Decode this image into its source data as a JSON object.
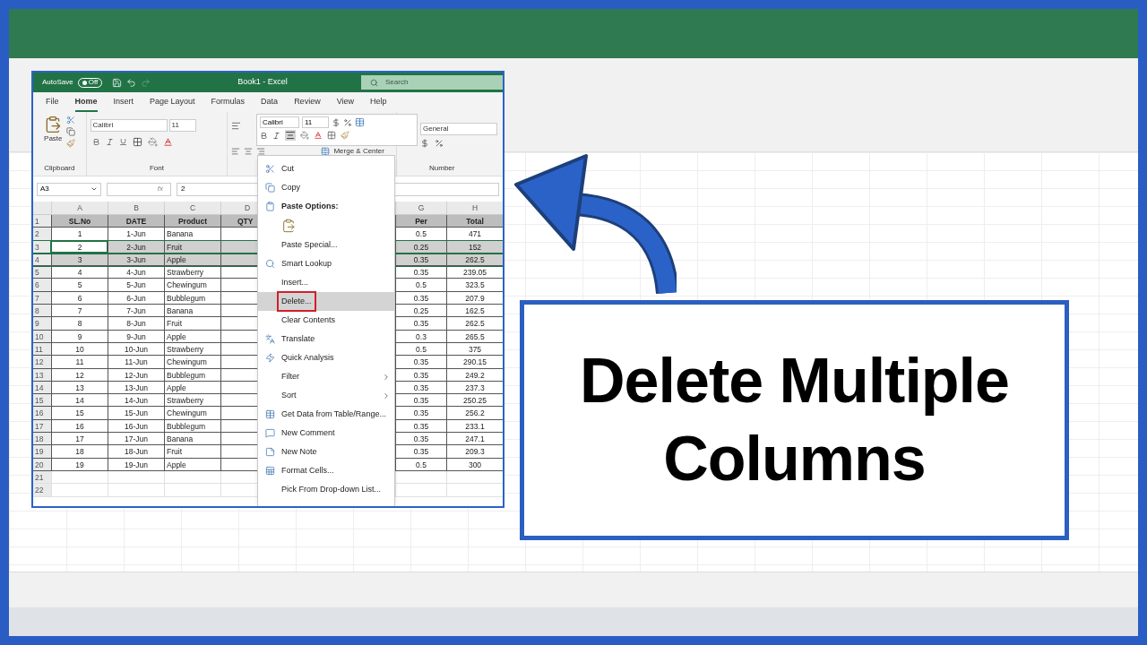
{
  "excel": {
    "autosave": {
      "label": "AutoSave",
      "on": false,
      "state_text": "Off"
    },
    "title": "Book1 - Excel",
    "search": {
      "placeholder": "Search"
    },
    "tabs": [
      {
        "label": "File",
        "selected": false
      },
      {
        "label": "Home",
        "selected": true
      },
      {
        "label": "Insert",
        "selected": false
      },
      {
        "label": "Page Layout",
        "selected": false
      },
      {
        "label": "Formulas",
        "selected": false
      },
      {
        "label": "Data",
        "selected": false
      },
      {
        "label": "Review",
        "selected": false
      },
      {
        "label": "View",
        "selected": false
      },
      {
        "label": "Help",
        "selected": false
      }
    ],
    "ribbon": {
      "paste_label": "Paste",
      "font_name": "Calibri",
      "font_size": "11",
      "merge_label": "Merge & Center",
      "number_format": "General",
      "groups": [
        "Clipboard",
        "Font",
        "Number"
      ]
    },
    "mini_toolbar": {
      "font_name": "Calibri",
      "font_size": "11"
    },
    "name_box": "A3",
    "function_label": "fx",
    "formula": "2",
    "columns": [
      "A",
      "B",
      "C",
      "D",
      "G",
      "H"
    ],
    "rows": [
      {
        "number": "1",
        "kind": "header",
        "selected": false,
        "active": false,
        "a": "SL.No",
        "b": "DATE",
        "c": "Product",
        "d": "QTY",
        "g": "Per",
        "h": "Total"
      },
      {
        "number": "2",
        "kind": "data",
        "selected": false,
        "active": false,
        "a": "1",
        "b": "1-Jun",
        "c": "Banana",
        "g": "0.5",
        "h": "471"
      },
      {
        "number": "3",
        "kind": "data",
        "selected": true,
        "active": true,
        "a": "2",
        "b": "2-Jun",
        "c": "Fruit",
        "g": "0.25",
        "h": "152"
      },
      {
        "number": "4",
        "kind": "data",
        "selected": true,
        "active": false,
        "a": "3",
        "b": "3-Jun",
        "c": "Apple",
        "g": "0.35",
        "h": "262.5"
      },
      {
        "number": "5",
        "kind": "data",
        "selected": false,
        "active": false,
        "a": "4",
        "b": "4-Jun",
        "c": "Strawberry",
        "g": "0.35",
        "h": "239.05"
      },
      {
        "number": "6",
        "kind": "data",
        "selected": false,
        "active": false,
        "a": "5",
        "b": "5-Jun",
        "c": "Chewingum",
        "g": "0.5",
        "h": "323.5"
      },
      {
        "number": "7",
        "kind": "data",
        "selected": false,
        "active": false,
        "a": "6",
        "b": "6-Jun",
        "c": "Bubblegum",
        "g": "0.35",
        "h": "207.9"
      },
      {
        "number": "8",
        "kind": "data",
        "selected": false,
        "active": false,
        "a": "7",
        "b": "7-Jun",
        "c": "Banana",
        "g": "0.25",
        "h": "162.5"
      },
      {
        "number": "9",
        "kind": "data",
        "selected": false,
        "active": false,
        "a": "8",
        "b": "8-Jun",
        "c": "Fruit",
        "g": "0.35",
        "h": "262.5"
      },
      {
        "number": "10",
        "kind": "data",
        "selected": false,
        "active": false,
        "a": "9",
        "b": "9-Jun",
        "c": "Apple",
        "g": "0.3",
        "h": "265.5"
      },
      {
        "number": "11",
        "kind": "data",
        "selected": false,
        "active": false,
        "a": "10",
        "b": "10-Jun",
        "c": "Strawberry",
        "g": "0.5",
        "h": "375"
      },
      {
        "number": "12",
        "kind": "data",
        "selected": false,
        "active": false,
        "a": "11",
        "b": "11-Jun",
        "c": "Chewingum",
        "g": "0.35",
        "h": "290.15"
      },
      {
        "number": "13",
        "kind": "data",
        "selected": false,
        "active": false,
        "a": "12",
        "b": "12-Jun",
        "c": "Bubblegum",
        "g": "0.35",
        "h": "249.2"
      },
      {
        "number": "14",
        "kind": "data",
        "selected": false,
        "active": false,
        "a": "13",
        "b": "13-Jun",
        "c": "Apple",
        "g": "0.35",
        "h": "237.3"
      },
      {
        "number": "15",
        "kind": "data",
        "selected": false,
        "active": false,
        "a": "14",
        "b": "14-Jun",
        "c": "Strawberry",
        "g": "0.35",
        "h": "250.25"
      },
      {
        "number": "16",
        "kind": "data",
        "selected": false,
        "active": false,
        "a": "15",
        "b": "15-Jun",
        "c": "Chewingum",
        "g": "0.35",
        "h": "256.2"
      },
      {
        "number": "17",
        "kind": "data",
        "selected": false,
        "active": false,
        "a": "16",
        "b": "16-Jun",
        "c": "Bubblegum",
        "g": "0.35",
        "h": "233.1"
      },
      {
        "number": "18",
        "kind": "data",
        "selected": false,
        "active": false,
        "a": "17",
        "b": "17-Jun",
        "c": "Banana",
        "g": "0.35",
        "h": "247.1"
      },
      {
        "number": "19",
        "kind": "data",
        "selected": false,
        "active": false,
        "a": "18",
        "b": "18-Jun",
        "c": "Fruit",
        "g": "0.35",
        "h": "209.3"
      },
      {
        "number": "20",
        "kind": "data",
        "selected": false,
        "active": false,
        "a": "19",
        "b": "19-Jun",
        "c": "Apple",
        "g": "0.5",
        "h": "300"
      },
      {
        "number": "21",
        "kind": "blank",
        "selected": false,
        "active": false
      },
      {
        "number": "22",
        "kind": "blank",
        "selected": false,
        "active": false
      }
    ],
    "context_menu": [
      {
        "label": "Cut",
        "kind": "item",
        "submenu": false,
        "selected": false
      },
      {
        "label": "Copy",
        "kind": "item",
        "submenu": false,
        "selected": false
      },
      {
        "label": "Paste Options:",
        "kind": "header",
        "submenu": false,
        "selected": false
      },
      {
        "kind": "paste-icons",
        "submenu": false,
        "selected": false
      },
      {
        "label": "Paste Special...",
        "kind": "item",
        "submenu": false,
        "selected": false
      },
      {
        "label": "Smart Lookup",
        "kind": "item",
        "submenu": false,
        "selected": false
      },
      {
        "label": "Insert...",
        "kind": "item",
        "submenu": false,
        "selected": false
      },
      {
        "label": "Delete...",
        "kind": "item",
        "submenu": false,
        "selected": true
      },
      {
        "label": "Clear Contents",
        "kind": "item",
        "submenu": false,
        "selected": false
      },
      {
        "label": "Translate",
        "kind": "item",
        "submenu": false,
        "selected": false
      },
      {
        "label": "Quick Analysis",
        "kind": "item",
        "submenu": false,
        "selected": false
      },
      {
        "label": "Filter",
        "kind": "item",
        "submenu": true,
        "selected": false
      },
      {
        "label": "Sort",
        "kind": "item",
        "submenu": true,
        "selected": false
      },
      {
        "label": "Get Data from Table/Range...",
        "kind": "item",
        "submenu": false,
        "selected": false
      },
      {
        "label": "New Comment",
        "kind": "item",
        "submenu": false,
        "selected": false
      },
      {
        "label": "New Note",
        "kind": "item",
        "submenu": false,
        "selected": false
      },
      {
        "label": "Format Cells...",
        "kind": "item",
        "submenu": false,
        "selected": false
      },
      {
        "label": "Pick From Drop-down List...",
        "kind": "item",
        "submenu": false,
        "selected": false
      }
    ]
  },
  "headline": "Delete Multiple Columns"
}
